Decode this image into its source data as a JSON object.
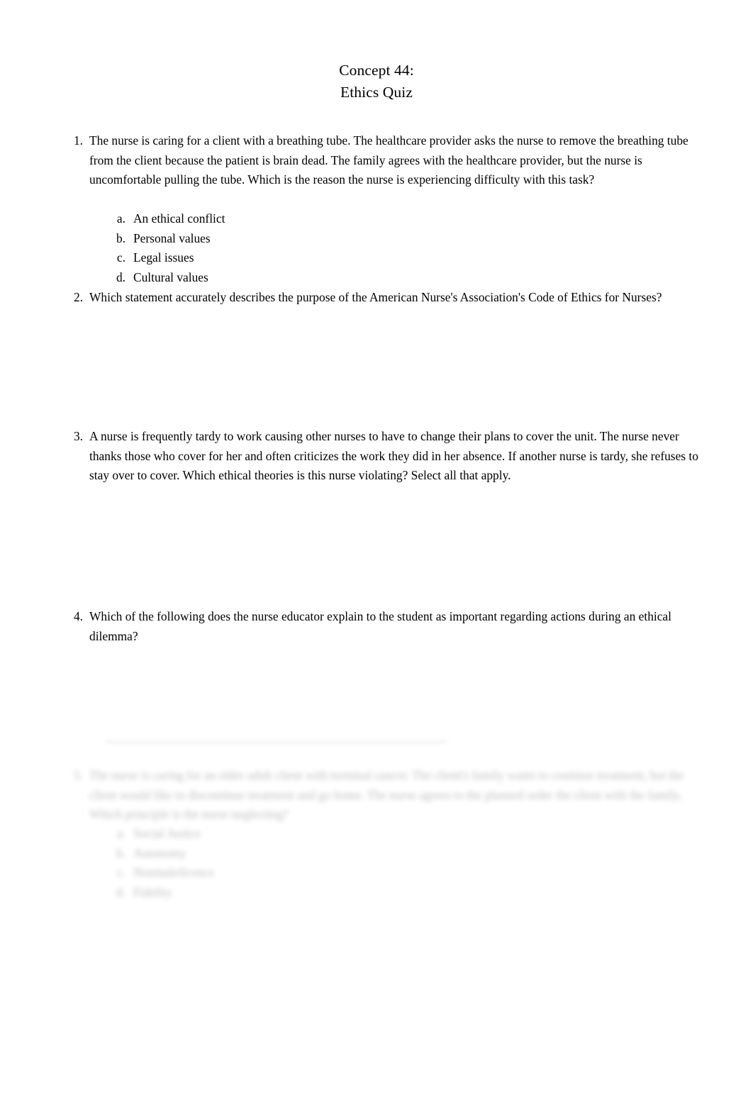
{
  "document": {
    "title_lines": [
      "Concept 44:",
      "Ethics Quiz"
    ],
    "background_color": "#ffffff",
    "text_color": "#000000"
  },
  "questions": [
    {
      "number": "1.",
      "text": "The nurse is caring for a client with a breathing tube. The healthcare provider asks the nurse to remove the breathing tube from the client because the patient is brain dead. The family agrees with the healthcare provider, but the nurse is uncomfortable pulling the tube. Which is the reason the nurse is experiencing difficulty with this task?",
      "options": [
        {
          "letter": "a.",
          "text": "An ethical conflict"
        },
        {
          "letter": "b.",
          "text": "Personal values"
        },
        {
          "letter": "c.",
          "text": "Legal issues"
        },
        {
          "letter": "d.",
          "text": "Cultural values"
        }
      ]
    },
    {
      "number": "2.",
      "text": "Which statement accurately describes the purpose of the American Nurse's Association's Code of Ethics for Nurses?",
      "options": []
    },
    {
      "number": "3.",
      "text": "A nurse is frequently tardy to work causing other nurses to have to change their plans to cover the unit. The nurse never thanks those who cover for her and often criticizes the work they did in her absence. If another nurse is tardy, she refuses to stay over to cover. Which ethical theories is this nurse violating? Select all that apply.",
      "options": []
    },
    {
      "number": "4.",
      "text": "Which of the following does the nurse educator explain to the student as important regarding actions during an ethical dilemma?",
      "options": []
    }
  ],
  "faded_question": {
    "number": "5.",
    "text": "The nurse is caring for an older adult client with terminal cancer. The client's family wants to continue treatment, but the client would like to discontinue treatment and go home. The nurse agrees to the planned order the client with the family. Which principle is the nurse neglecting?",
    "options": [
      {
        "letter": "a.",
        "text": "Social Justice"
      },
      {
        "letter": "b.",
        "text": "Autonomy"
      },
      {
        "letter": "c.",
        "text": "Nonmaleficence"
      },
      {
        "letter": "d.",
        "text": "Fidelity"
      }
    ]
  }
}
